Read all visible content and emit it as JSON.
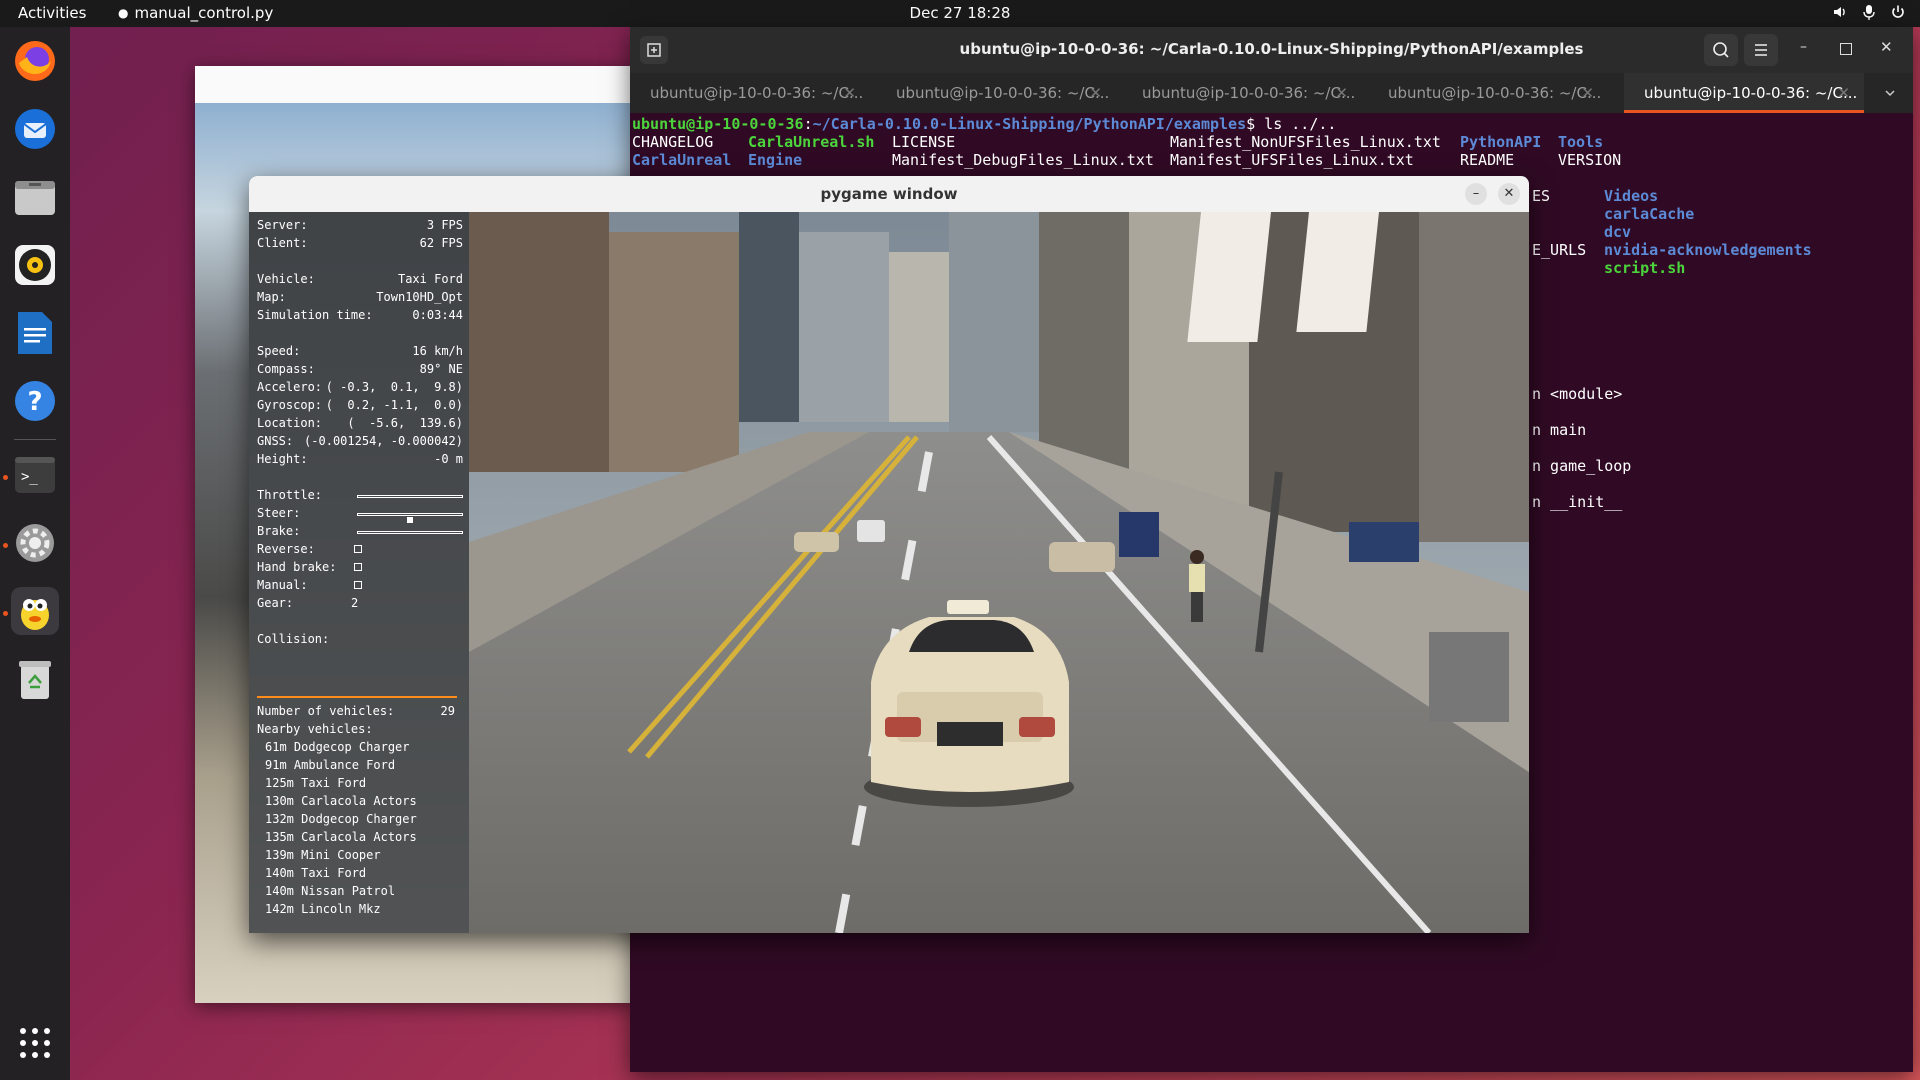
{
  "topbar": {
    "activities": "Activities",
    "app_name": "manual_control.py",
    "clock": "Dec 27  18:28"
  },
  "dock": {
    "items": [
      "firefox-icon",
      "thunderbird-icon",
      "files-icon",
      "rhythmbox-icon",
      "writer-icon",
      "help-icon",
      "terminal-icon",
      "settings-icon",
      "pygame-icon",
      "trash-icon",
      "app-grid-icon"
    ]
  },
  "terminal": {
    "title": "ubuntu@ip-10-0-0-36: ~/Carla-0.10.0-Linux-Shipping/PythonAPI/examples",
    "tabs": [
      "ubuntu@ip-10-0-0-36: ~/C...",
      "ubuntu@ip-10-0-0-36: ~/C...",
      "ubuntu@ip-10-0-0-36: ~/C...",
      "ubuntu@ip-10-0-0-36: ~/C...",
      "ubuntu@ip-10-0-0-36: ~/C..."
    ],
    "active_tab": 4,
    "prompt_user": "ubuntu@ip-10-0-0-36",
    "prompt_path": "~/Carla-0.10.0-Linux-Shipping/PythonAPI/examples",
    "command": "$ ls ../..",
    "row1": {
      "a": "CHANGELOG",
      "b": "CarlaUnreal.sh",
      "c": "LICENSE",
      "d": "Manifest_NonUFSFiles_Linux.txt",
      "e": "PythonAPI",
      "f": "Tools"
    },
    "row2": {
      "a": "CarlaUnreal",
      "b": "Engine",
      "c": "Manifest_DebugFiles_Linux.txt",
      "d": "Manifest_UFSFiles_Linux.txt",
      "e": "README",
      "f": "VERSION"
    },
    "right_col": {
      "r1a": "ES",
      "r1b": "Videos",
      "r2": "carlaCache",
      "r3": "dcv",
      "r4a": "E_URLS",
      "r4b": "nvidia-acknowledgements",
      "r5": "script.sh"
    },
    "trace": [
      "n <module>",
      "n main",
      "n game_loop",
      "n __init__"
    ]
  },
  "pygame": {
    "title": "pygame window",
    "hud": {
      "server_label": "Server:",
      "server": "3 FPS",
      "client_label": "Client:",
      "client": "62 FPS",
      "vehicle_label": "Vehicle:",
      "vehicle": "Taxi Ford",
      "map_label": "Map:",
      "map": "Town10HD_Opt",
      "simtime_label": "Simulation time:",
      "simtime": "0:03:44",
      "speed_label": "Speed:",
      "speed": "16 km/h",
      "compass_label": "Compass:",
      "compass": "89° NE",
      "accel_label": "Accelero:",
      "accel": "( -0.3,  0.1,  9.8)",
      "gyro_label": "Gyroscop:",
      "gyro": "(  0.2, -1.1,  0.0)",
      "location_label": "Location:",
      "location": "(  -5.6,  139.6)",
      "gnss_label": "GNSS:",
      "gnss": "(-0.001254, -0.000042)",
      "height_label": "Height:",
      "height": "-0 m",
      "throttle_label": "Throttle:",
      "throttle": 0.0,
      "steer_label": "Steer:",
      "steer": 0.0,
      "brake_label": "Brake:",
      "brake": 0.0,
      "reverse_label": "Reverse:",
      "handbrake_label": "Hand brake:",
      "manual_label": "Manual:",
      "gear_label": "Gear:",
      "gear": "2",
      "collision_label": "Collision:",
      "num_vehicles_label": "Number of vehicles:",
      "num_vehicles": "29",
      "nearby_label": "Nearby vehicles:",
      "nearby": [
        "61m Dodgecop Charger",
        "91m Ambulance Ford",
        "125m Taxi Ford",
        "130m Carlacola Actors",
        "132m Dodgecop Charger",
        "135m Carlacola Actors",
        "139m Mini Cooper",
        "140m Taxi Ford",
        "140m Nissan Patrol",
        "142m Lincoln Mkz"
      ]
    }
  }
}
